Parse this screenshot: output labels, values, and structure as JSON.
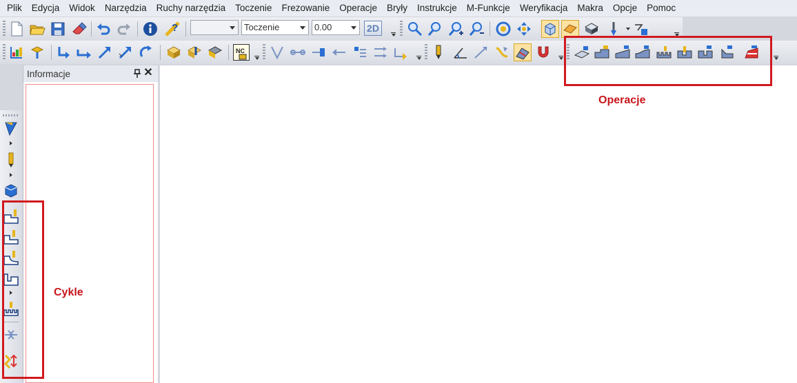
{
  "menu": [
    "Plik",
    "Edycja",
    "Widok",
    "Narzędzia",
    "Ruchy narzędzia",
    "Toczenie",
    "Frezowanie",
    "Operacje",
    "Bryły",
    "Instrukcje",
    "M-Funkcje",
    "Weryfikacja",
    "Makra",
    "Opcje",
    "Pomoc"
  ],
  "toolbar1": {
    "combo_empty_value": "",
    "mode_value": "Toczenie",
    "number_value": "0.00",
    "view_2d_label": "2D"
  },
  "panel": {
    "title": "Informacje"
  },
  "annotations": {
    "operations": "Operacje",
    "cycles": "Cykle"
  },
  "colors": {
    "annotation_red": "#d0191f",
    "accent_blue": "#2a6fd1",
    "accent_yellow": "#e7b51c"
  }
}
